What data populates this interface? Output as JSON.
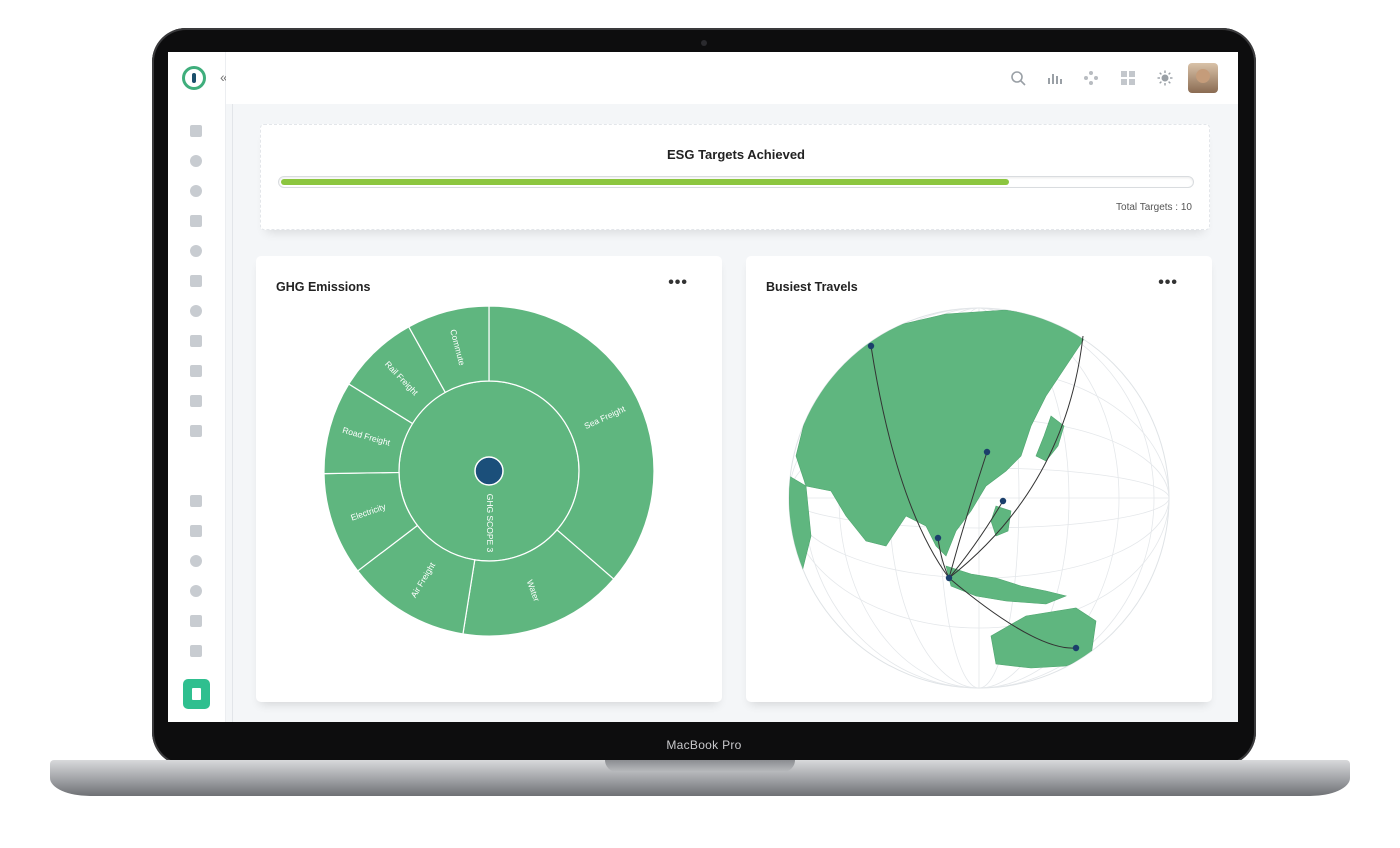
{
  "device": {
    "brand_label": "MacBook Pro"
  },
  "sidebar": {
    "icons": [
      "dashboard-icon",
      "modules-icon",
      "user-icon",
      "document-icon",
      "globe-icon",
      "bank-icon",
      "pie-chart-icon",
      "layers-icon",
      "report-icon",
      "analytics-icon",
      "layout-icon",
      "calendar-icon",
      "scale-icon",
      "hexagon-icon",
      "donut-icon",
      "grid-icon",
      "triangle-icon"
    ],
    "active_icon": "file-report-icon"
  },
  "topbar": {
    "icons": [
      "search-icon",
      "bar-chart-icon",
      "modules-icon",
      "apps-grid-icon",
      "sun-icon"
    ]
  },
  "targets": {
    "title": "ESG Targets Achieved",
    "progress": 0.8,
    "total_label": "Total Targets : 10",
    "fill_color": "#8cc63f"
  },
  "ghg": {
    "title": "GHG Emissions",
    "menu_label": "•••",
    "chart_data": {
      "type": "sunburst",
      "color": "#5fb67f",
      "center_color": "#1b4f7a",
      "inner": [
        {
          "name": "GHG SCOPE 3",
          "value": 100
        }
      ],
      "outer": [
        {
          "name": "Sea Freight",
          "value": 36
        },
        {
          "name": "Water",
          "value": 16
        },
        {
          "name": "Air Freight",
          "value": 12
        },
        {
          "name": "Electricity",
          "value": 10
        },
        {
          "name": "Road Freight",
          "value": 9
        },
        {
          "name": "Rail Freight",
          "value": 8
        },
        {
          "name": "Commute",
          "value": 8
        }
      ]
    }
  },
  "travels": {
    "title": "Busiest Travels",
    "menu_label": "•••",
    "map_color": "#5fb67f",
    "point_color": "#1b3f6b"
  }
}
